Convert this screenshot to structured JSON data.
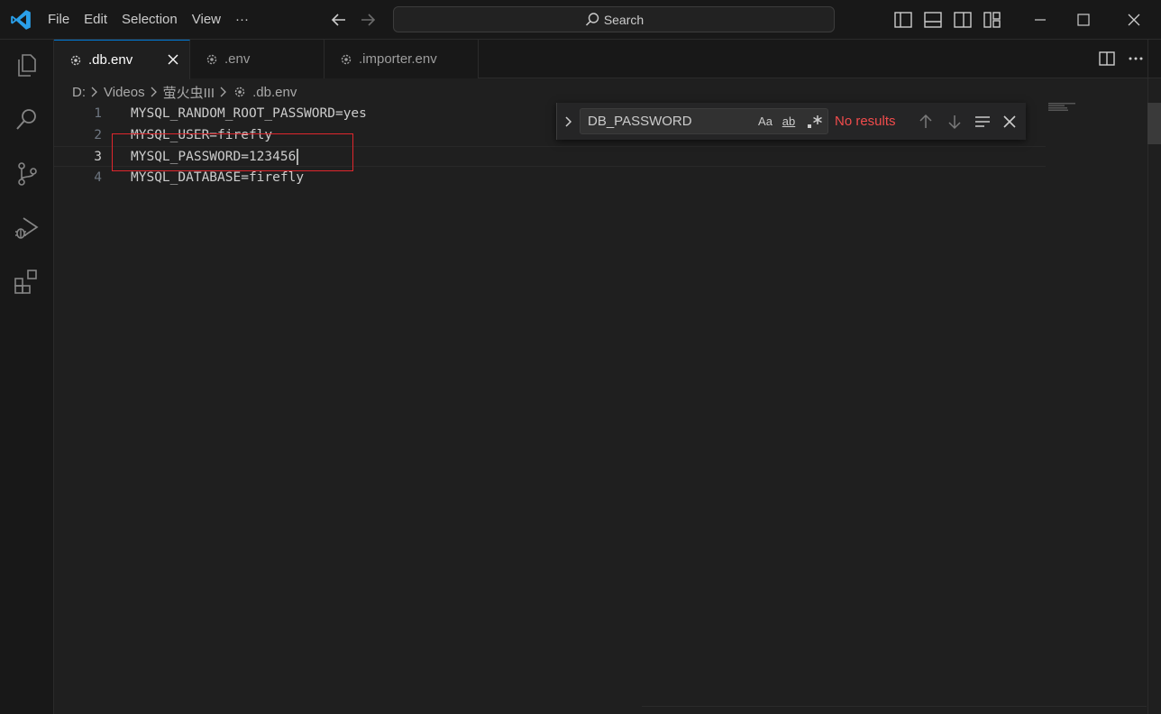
{
  "menu": {
    "file": "File",
    "edit": "Edit",
    "selection": "Selection",
    "view": "View",
    "more": "···"
  },
  "search": {
    "label": "Search"
  },
  "tabs": [
    {
      "label": ".db.env",
      "active": true
    },
    {
      "label": ".env",
      "active": false
    },
    {
      "label": ".importer.env",
      "active": false
    }
  ],
  "breadcrumb": {
    "drive": "D:",
    "folder1": "Videos",
    "folder2": "萤火虫III",
    "file": ".db.env"
  },
  "editor": {
    "lines": [
      {
        "num": "1",
        "text": "MYSQL_RANDOM_ROOT_PASSWORD=yes"
      },
      {
        "num": "2",
        "text": "MYSQL_USER=firefly"
      },
      {
        "num": "3",
        "text": "MYSQL_PASSWORD=123456"
      },
      {
        "num": "4",
        "text": "MYSQL_DATABASE=firefly"
      }
    ],
    "current_line": "3"
  },
  "find": {
    "query": "DB_PASSWORD",
    "match_case": "Aa",
    "whole_word": "ab",
    "status": "No results"
  },
  "colors": {
    "accent": "#0078d4",
    "error": "#f14c4c",
    "highlight_box": "#e0262d",
    "background": "#1f1f1f"
  }
}
